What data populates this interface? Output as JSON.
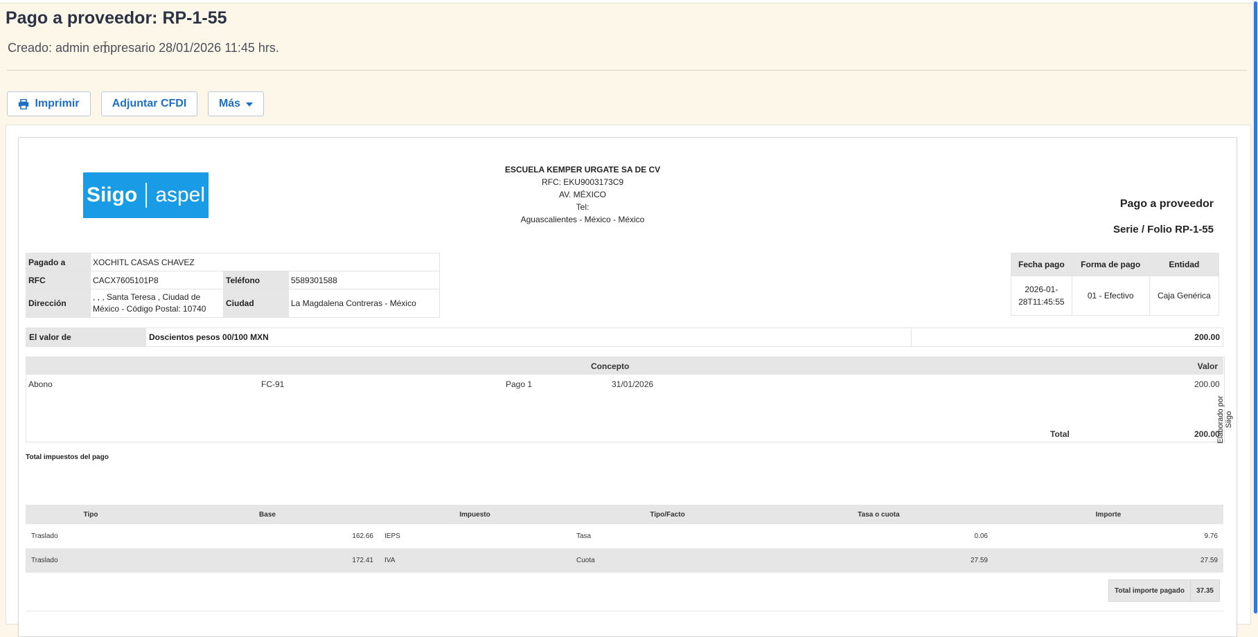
{
  "header": {
    "title": "Pago a proveedor: RP-1-55",
    "created": "Creado: admin empresario 28/01/2026 11:45 hrs."
  },
  "toolbar": {
    "print_label": "Imprimir",
    "cfdi_label": "Adjuntar CFDI",
    "more_label": "Más"
  },
  "logo": {
    "left": "Siigo",
    "right": "aspel"
  },
  "company": {
    "name": "ESCUELA KEMPER URGATE SA DE CV",
    "rfc": "RFC: EKU9003173C9",
    "address": "AV. MÉXICO",
    "tel": "Tel:",
    "location": "Aguascalientes - México - México"
  },
  "document": {
    "type": "Pago a proveedor",
    "folio": "Serie / Folio RP-1-55"
  },
  "payee": {
    "paid_to_label": "Pagado a",
    "paid_to": "XOCHITL CASAS CHAVEZ",
    "rfc_label": "RFC",
    "rfc": "CACX7605101P8",
    "phone_label": "Teléfono",
    "phone": "5589301588",
    "address_label": "Dirección",
    "address_line1": ", , , Santa Teresa , Ciudad de",
    "address_line2": "México - Código Postal: 10740",
    "city_label": "Ciudad",
    "city": "La Magdalena Contreras - México"
  },
  "payment": {
    "headers": [
      "Fecha pago",
      "Forma de pago",
      "Entidad"
    ],
    "date_line1": "2026-01-",
    "date_line2": "28T11:45:55",
    "method": "01 - Efectivo",
    "entity": "Caja Genérica"
  },
  "amount": {
    "label": "El valor de",
    "words": "Doscientos pesos 00/100 MXN",
    "value": "200.00"
  },
  "concepts": {
    "header_concept": "Concepto",
    "header_value": "Valor",
    "row": {
      "type": "Abono",
      "doc": "FC-91",
      "payment": "Pago 1",
      "date": "31/01/2026",
      "value": "200.00"
    },
    "total_label": "Total",
    "total_value": "200.00",
    "side_text": "Elaborado por Siigo"
  },
  "taxes": {
    "title": "Total impuestos del pago",
    "headers": [
      "Tipo",
      "Base",
      "Impuesto",
      "Tipo/Facto",
      "Tasa o cuota",
      "Importe"
    ],
    "rows": [
      [
        "Traslado",
        "162.66",
        "IEPS",
        "Tasa",
        "0.06",
        "9.76"
      ],
      [
        "Traslado",
        "172.41",
        "IVA",
        "Cuota",
        "27.59",
        "27.59"
      ]
    ],
    "total_label": "Total importe pagado",
    "total_value": "37.35"
  },
  "colors": {
    "accent": "#1d6fc3",
    "background": "#fdf7ea",
    "logo": "#1a9be6",
    "header_gray": "#e6e6e6"
  }
}
